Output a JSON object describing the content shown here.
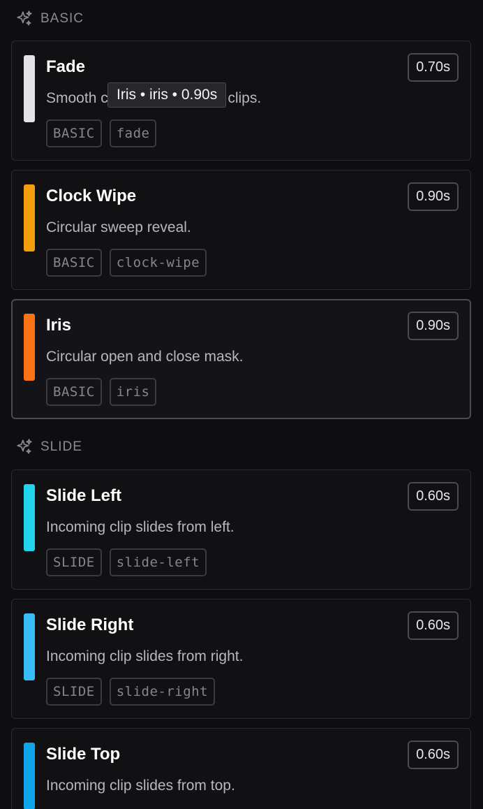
{
  "sections": [
    {
      "label": "BASIC",
      "cards": [
        {
          "title": "Fade",
          "description": "Smooth crossfade between clips.",
          "duration": "0.70s",
          "color": "#e4e4e7",
          "tags": [
            "BASIC",
            "fade"
          ]
        },
        {
          "title": "Clock Wipe",
          "description": "Circular sweep reveal.",
          "duration": "0.90s",
          "color": "#f59e0b",
          "tags": [
            "BASIC",
            "clock-wipe"
          ]
        },
        {
          "title": "Iris",
          "description": "Circular open and close mask.",
          "duration": "0.90s",
          "color": "#f97316",
          "tags": [
            "BASIC",
            "iris"
          ]
        }
      ]
    },
    {
      "label": "SLIDE",
      "cards": [
        {
          "title": "Slide Left",
          "description": "Incoming clip slides from left.",
          "duration": "0.60s",
          "color": "#22d3ee",
          "tags": [
            "SLIDE",
            "slide-left"
          ]
        },
        {
          "title": "Slide Right",
          "description": "Incoming clip slides from right.",
          "duration": "0.60s",
          "color": "#38bdf8",
          "tags": [
            "SLIDE",
            "slide-right"
          ]
        },
        {
          "title": "Slide Top",
          "description": "Incoming clip slides from top.",
          "duration": "0.60s",
          "color": "#0ea5e9",
          "tags": []
        }
      ]
    }
  ],
  "tooltip": {
    "text": "Iris • iris • 0.90s"
  },
  "selected_card": "Iris",
  "icons": {
    "section": "sparkles-icon"
  }
}
